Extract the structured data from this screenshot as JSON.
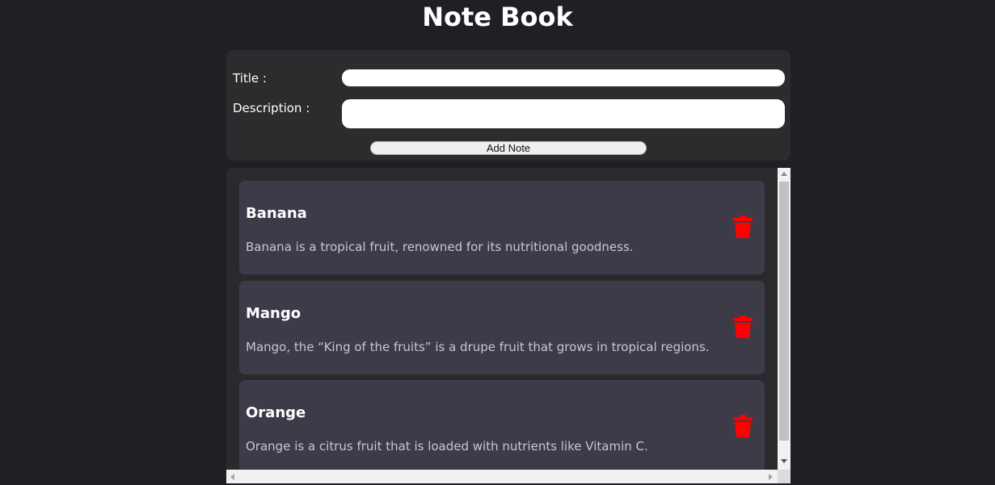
{
  "app": {
    "title": "Note Book"
  },
  "form": {
    "title_label": "Title :",
    "title_value": "",
    "description_label": "Description :",
    "description_value": "",
    "add_button_label": "Add Note"
  },
  "notes": [
    {
      "title": "Banana",
      "description": "Banana is a tropical fruit, renowned for its nutritional goodness."
    },
    {
      "title": "Mango",
      "description": "Mango, the “King of the fruits” is a drupe fruit that grows in tropical regions."
    },
    {
      "title": "Orange",
      "description": "Orange is a citrus fruit that is loaded with nutrients like Vitamin C."
    }
  ],
  "colors": {
    "background": "#202024",
    "panel": "#2c2c2e",
    "card": "#3d3b48",
    "delete_icon": "#ff0000"
  },
  "icons": {
    "delete": "trash-icon"
  }
}
